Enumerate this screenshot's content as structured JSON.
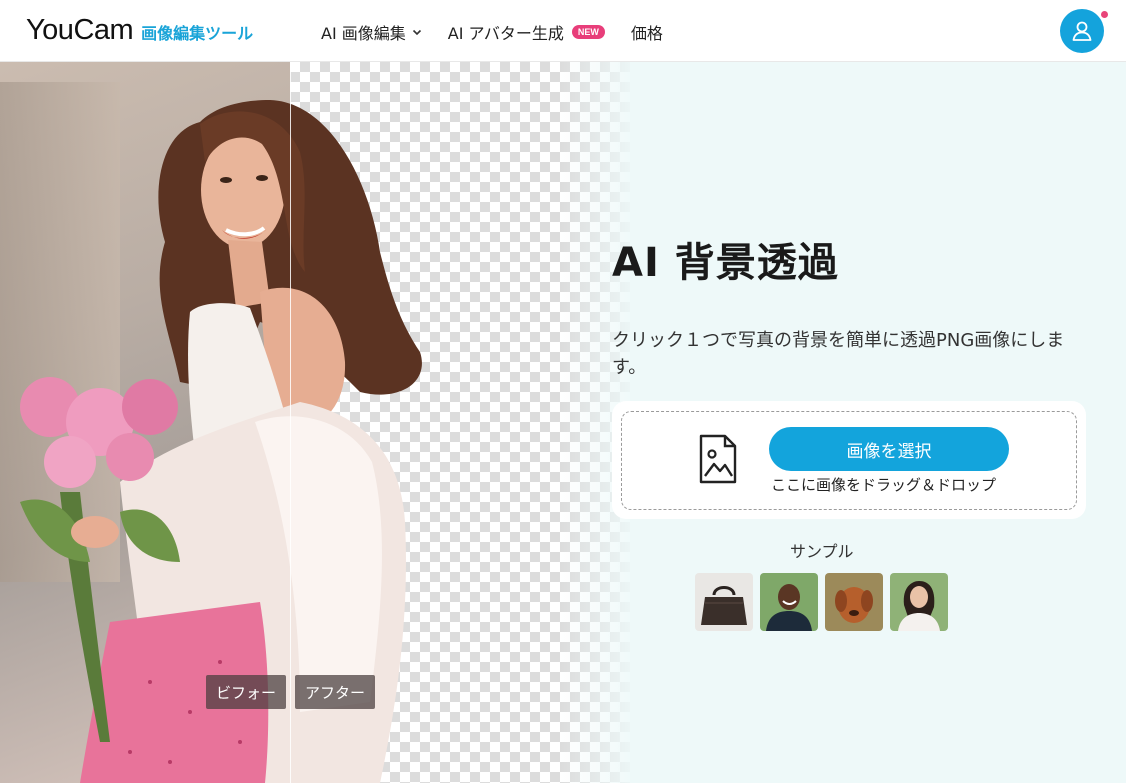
{
  "header": {
    "logo_word": "YouCam",
    "logo_sub": "画像編集ツール",
    "nav": [
      {
        "label": "AI 画像編集"
      },
      {
        "label": "AI アバター生成",
        "badge": "NEW"
      },
      {
        "label": "価格"
      }
    ]
  },
  "hero": {
    "before_label": "ビフォー",
    "after_label": "アフター"
  },
  "panel": {
    "title": "AI 背景透過",
    "description": "クリック１つで写真の背景を簡単に透過PNG画像にします。",
    "select_button": "画像を選択",
    "drag_hint": "ここに画像をドラッグ＆ドロップ",
    "sample_label": "サンプル"
  },
  "samples": [
    "handbag",
    "man-portrait",
    "dog",
    "woman-portrait"
  ],
  "colors": {
    "accent": "#13a4dc",
    "badge": "#e83e7a",
    "panel_bg": "#eef9f9"
  }
}
